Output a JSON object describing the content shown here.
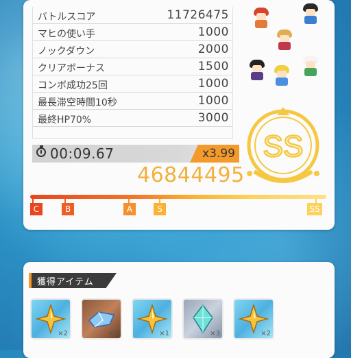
{
  "scores": [
    {
      "label": "バトルスコア",
      "value": "11726475"
    },
    {
      "label": "マヒの使い手",
      "value": "1000"
    },
    {
      "label": "ノックダウン",
      "value": "2000"
    },
    {
      "label": "クリアボーナス",
      "value": "1500"
    },
    {
      "label": "コンボ成功25回",
      "value": "1000"
    },
    {
      "label": "最長滞空時間10秒",
      "value": "1000"
    },
    {
      "label": "最終HP70%",
      "value": "3000"
    }
  ],
  "timer": "00:09.67",
  "multiplier": "x3.99",
  "total_score": "46844495",
  "rank": "SS",
  "rank_scale": [
    "C",
    "B",
    "A",
    "S",
    "SS"
  ],
  "items_header": "獲得アイテム",
  "items": [
    {
      "icon": "gold-star-crystal-icon",
      "qty": "×2"
    },
    {
      "icon": "blue-gem-icon",
      "qty": "×5"
    },
    {
      "icon": "gold-star-crystal-icon",
      "qty": "×1"
    },
    {
      "icon": "teal-crystal-icon",
      "qty": "×3"
    },
    {
      "icon": "gold-star-crystal-icon",
      "qty": "×2"
    }
  ],
  "colors": {
    "accent": "#f39a2a",
    "gold": "#f2b03c",
    "rank_c": "#e8461e"
  }
}
